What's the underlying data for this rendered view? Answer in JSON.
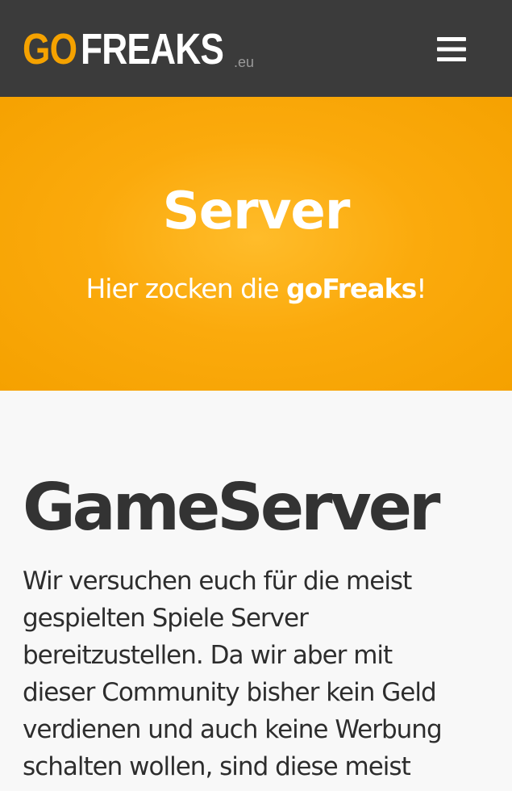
{
  "header": {
    "logo": {
      "go": "GO",
      "freaks": "FREAKS",
      "tld": ".eu"
    },
    "menu_icon": "hamburger-menu-icon"
  },
  "hero": {
    "title": "Server",
    "subtitle_prefix": "Hier zocken die ",
    "subtitle_brand": "goFreaks",
    "subtitle_suffix": "!"
  },
  "main": {
    "heading": "GameServer",
    "text_lines": [
      "Wir versuchen euch für die meist",
      "gespielten Spiele Server",
      "bereitzustellen. Da wir aber mit",
      "dieser Community bisher kein Geld",
      "verdienen und auch keine Werbung",
      "schalten wollen, sind diese meist"
    ]
  },
  "colors": {
    "topbar_bg": "#3b3b3b",
    "accent_orange": "#f5a200",
    "hero_text": "#ffffff",
    "body_text": "#333333",
    "page_bg": "#f8f8f8"
  }
}
